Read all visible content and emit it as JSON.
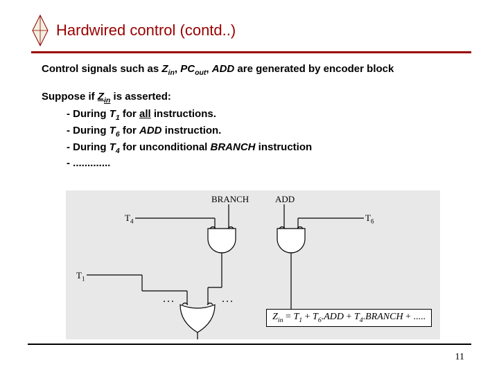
{
  "header": {
    "title": "Hardwired control (contd..)"
  },
  "body": {
    "intro_pre": "Control signals such as ",
    "sig1": "Z",
    "sig1_sub": "in",
    "sep1": ", ",
    "sig2": "PC",
    "sig2_sub": "out",
    "sep2": ", ",
    "sig3": "ADD",
    "intro_post": " are generated by encoder block",
    "suppose_pre": "Suppose if ",
    "suppose_sig": "Z",
    "suppose_sub": "in",
    "suppose_post": " is asserted:",
    "b1_pre": "- During ",
    "b1_t": "T",
    "b1_tn": "1",
    "b1_mid": " for ",
    "b1_all": "all",
    "b1_post": " instructions.",
    "b2_pre": "- During ",
    "b2_t": "T",
    "b2_tn": "6",
    "b2_mid": " for ",
    "b2_sig": "ADD",
    "b2_post": " instruction.",
    "b3_pre": "- During ",
    "b3_t": "T",
    "b3_tn": "4",
    "b3_mid": " for unconditional ",
    "b3_sig": "BRANCH",
    "b3_post": " instruction",
    "b4": "- ............."
  },
  "diagram": {
    "label_branch": "BRANCH",
    "label_add": "ADD",
    "label_t4": "T",
    "label_t4_sub": "4",
    "label_t6": "T",
    "label_t6_sub": "6",
    "label_t1": "T",
    "label_t1_sub": "1",
    "dots": "..."
  },
  "equation": {
    "lhs_z": "Z",
    "lhs_sub": "in",
    "eq": " = ",
    "t": "T",
    "n1": "1",
    "plus": " + ",
    "n6": "6",
    "dot": ".",
    "add": "ADD",
    "n4": "4",
    "branch": "BRANCH",
    "tail": " + ....."
  },
  "page": "11"
}
